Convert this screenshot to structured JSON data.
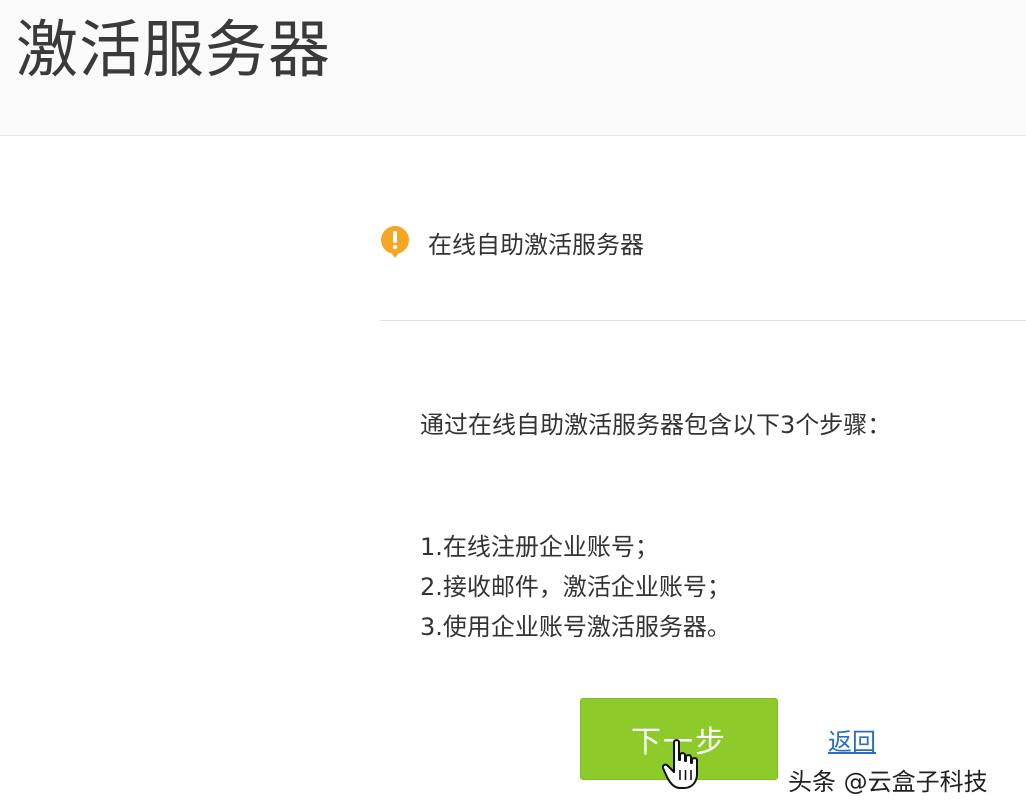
{
  "header": {
    "title": "激活服务器"
  },
  "notice": {
    "icon": "warning-icon",
    "icon_color": "#f5a623",
    "text": "在线自助激活服务器"
  },
  "content": {
    "intro": "通过在线自助激活服务器包含以下3个步骤：",
    "steps": [
      "1.在线注册企业账号；",
      "2.接收邮件，激活企业账号；",
      "3.使用企业账号激活服务器。"
    ]
  },
  "actions": {
    "next_label": "下一步",
    "next_color": "#8ccb2a",
    "back_label": "返回",
    "link_color": "#2a6fbf"
  },
  "watermark": {
    "text": "头条 @云盒子科技"
  }
}
